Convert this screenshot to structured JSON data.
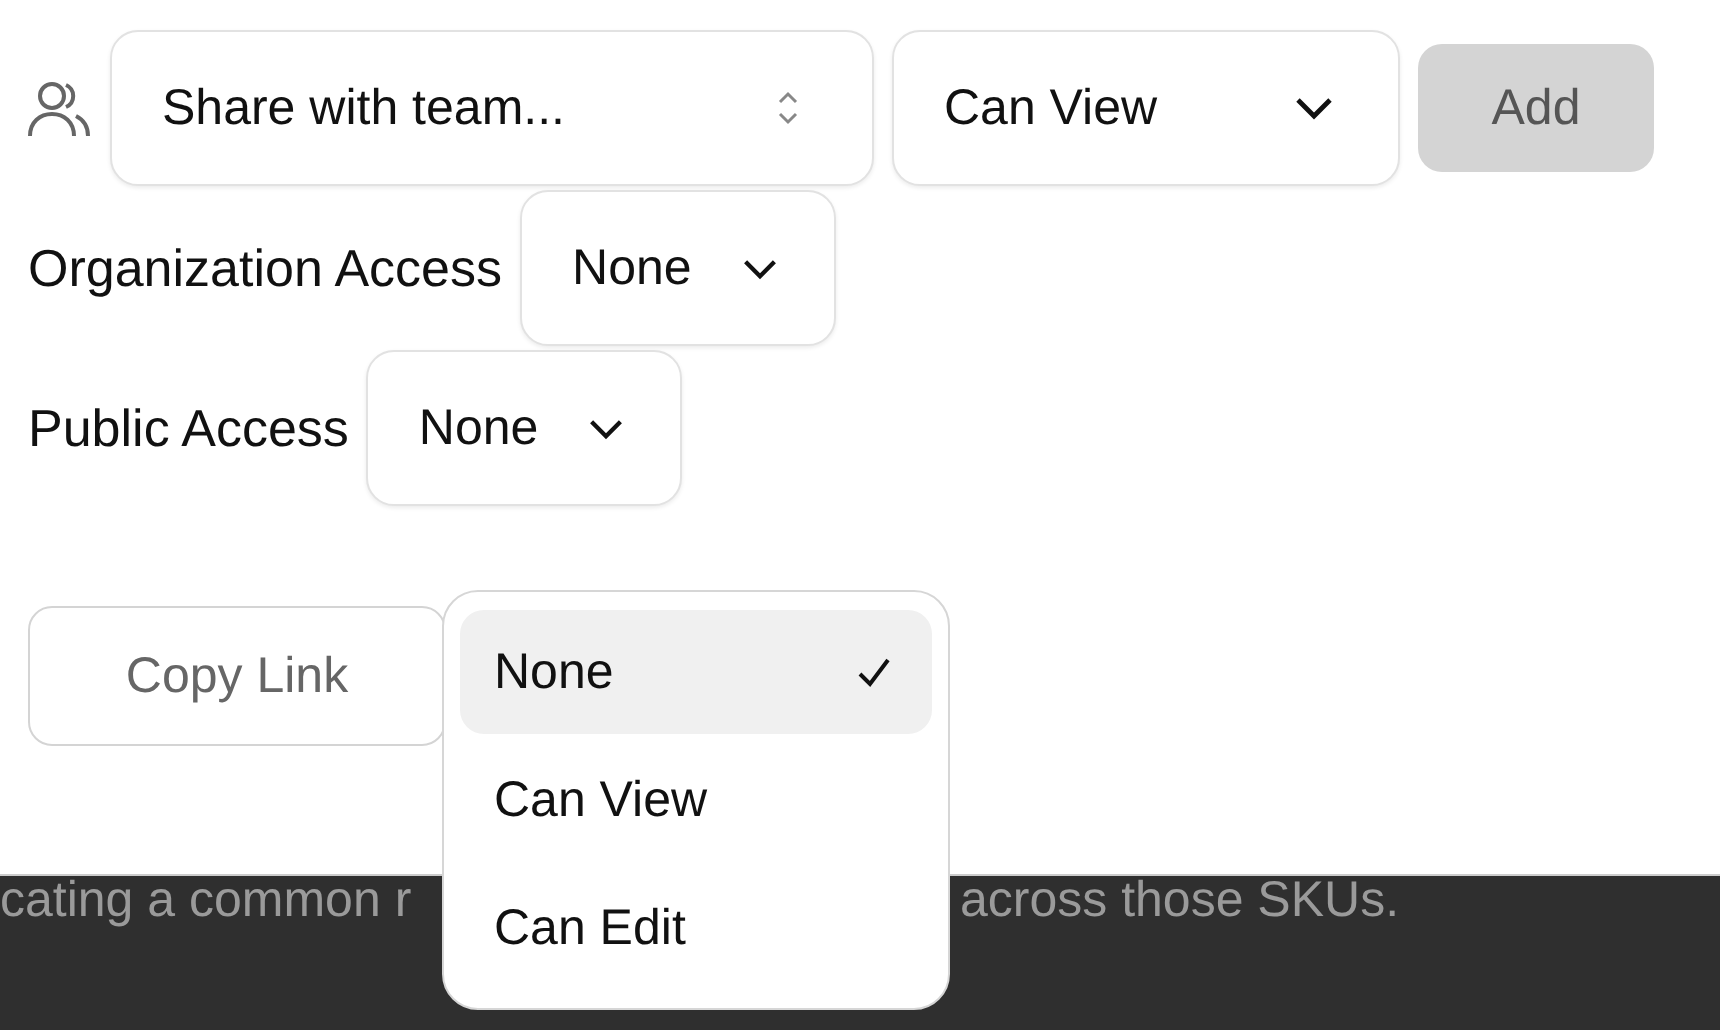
{
  "share": {
    "team_select": {
      "placeholder": "Share with team..."
    },
    "permission_select": {
      "value": "Can View"
    },
    "add_button": {
      "label": "Add",
      "disabled": true
    }
  },
  "access": [
    {
      "label": "Organization Access",
      "value": "None"
    },
    {
      "label": "Public Access",
      "value": "None"
    }
  ],
  "copy_link_button": {
    "label": "Copy Link"
  },
  "dropdown": {
    "options": [
      {
        "label": "None",
        "selected": true
      },
      {
        "label": "Can View",
        "selected": false
      },
      {
        "label": "Can Edit",
        "selected": false
      }
    ]
  },
  "background_text": [
    "cating a common r",
    "across those SKUs."
  ]
}
